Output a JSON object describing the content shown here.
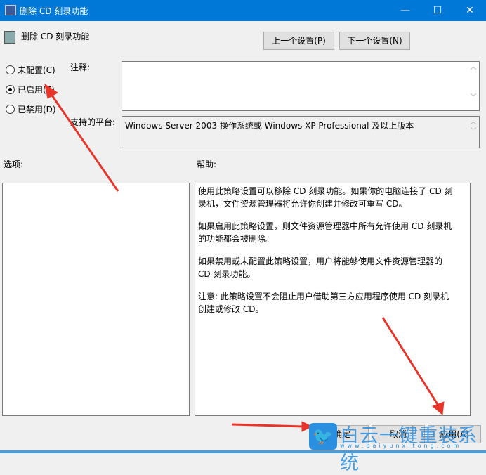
{
  "window": {
    "title": "删除 CD 刻录功能",
    "minimize": "—",
    "maximize": "☐",
    "close": "✕"
  },
  "header": {
    "policy_name": "删除 CD 刻录功能",
    "prev_button": "上一个设置(P)",
    "next_button": "下一个设置(N)"
  },
  "state": {
    "options": [
      {
        "label": "未配置(C)",
        "selected": false
      },
      {
        "label": "已启用(E)",
        "selected": true
      },
      {
        "label": "已禁用(D)",
        "selected": false
      }
    ]
  },
  "comment": {
    "label": "注释:",
    "value": ""
  },
  "platform": {
    "label": "支持的平台:",
    "value": "Windows Server 2003 操作系统或 Windows XP Professional 及以上版本"
  },
  "options_label": "选项:",
  "help": {
    "label": "帮助:",
    "paragraphs": [
      "使用此策略设置可以移除 CD 刻录功能。如果你的电脑连接了 CD 刻录机，文件资源管理器将允许你创建并修改可重写 CD。",
      "如果启用此策略设置，则文件资源管理器中所有允许使用 CD 刻录机的功能都会被删除。",
      "如果禁用或未配置此策略设置，用户将能够使用文件资源管理器的 CD 刻录功能。",
      "注意: 此策略设置不会阻止用户借助第三方应用程序使用 CD 刻录机创建或修改 CD。"
    ]
  },
  "footer": {
    "ok": "确定",
    "cancel": "取消",
    "apply": "应用(A)"
  },
  "watermark": {
    "text": "白云一键重装系统",
    "url": "www.baiyunxitong.com"
  },
  "colors": {
    "titlebar": "#0078d7",
    "arrow": "#e8352a",
    "watermark": "#2b8fe0"
  }
}
